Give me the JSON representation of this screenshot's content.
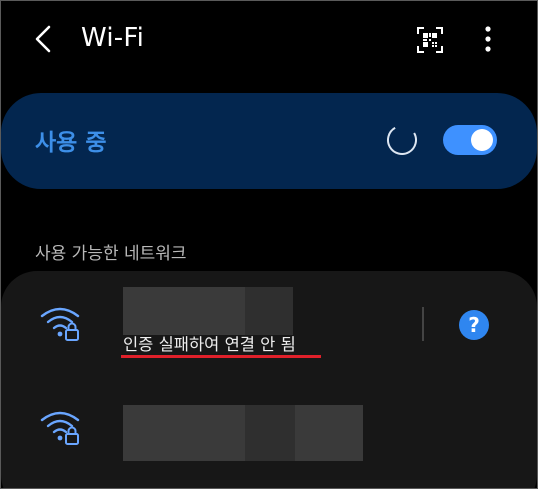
{
  "app_bar": {
    "title": "Wi-Fi",
    "back_icon": "chevron-left-icon",
    "qr_icon": "qr-scan-icon",
    "more_icon": "more-vertical-icon"
  },
  "master_switch": {
    "label": "사용 중",
    "state": "on",
    "scanning": true,
    "accent_color": "#3e91ff",
    "card_color": "#03264f"
  },
  "networks": {
    "header": "사용 가능한 네트워크",
    "items": [
      {
        "name_redacted": true,
        "status": "인증 실패하여 연결 안 됨",
        "icon": "wifi-lock-icon",
        "help_label": "?"
      },
      {
        "name_redacted": true,
        "status": "",
        "icon": "wifi-lock-icon"
      }
    ]
  }
}
